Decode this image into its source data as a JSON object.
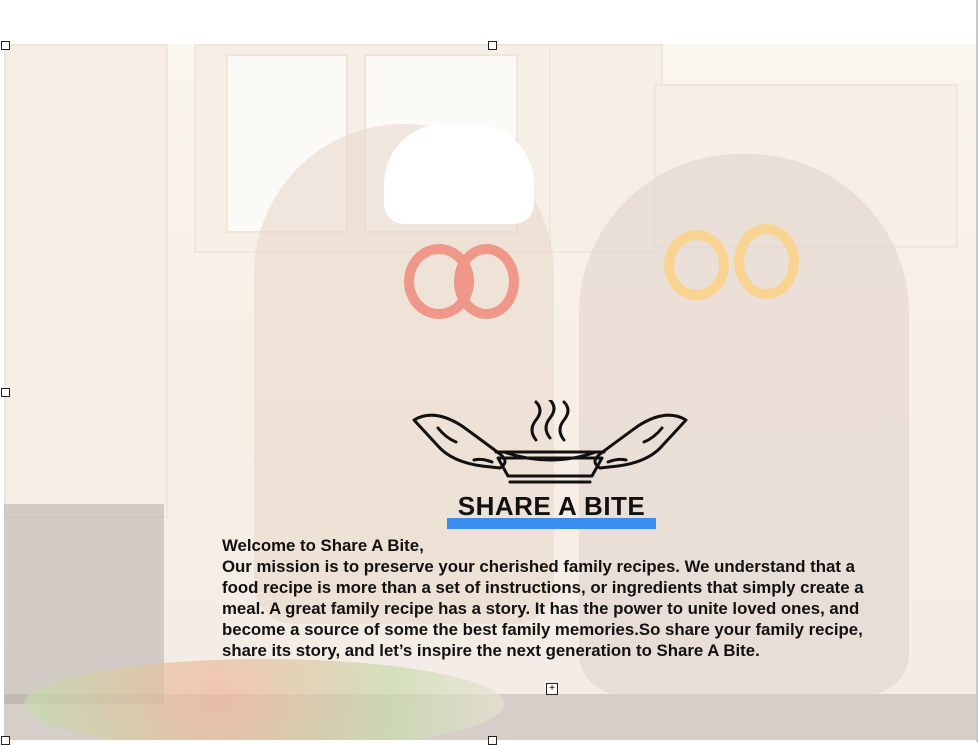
{
  "logo": {
    "name": "SHARE A BITE",
    "accent": "#3a8ef0"
  },
  "intro": {
    "greeting": "Welcome to Share A Bite,",
    "body": "Our mission is to preserve your cherished family recipes. We understand that a food recipe is more than a set of instructions, or ingredients that simply create a meal. A great family recipe has a story. It has the power to unite loved ones, and become a source of some the best family memories.So share your family recipe, share its story, and let’s inspire the next generation to Share A Bite."
  },
  "icons": {
    "selection_handle": "resize-handle-icon",
    "anchor": "anchor-move-icon"
  }
}
